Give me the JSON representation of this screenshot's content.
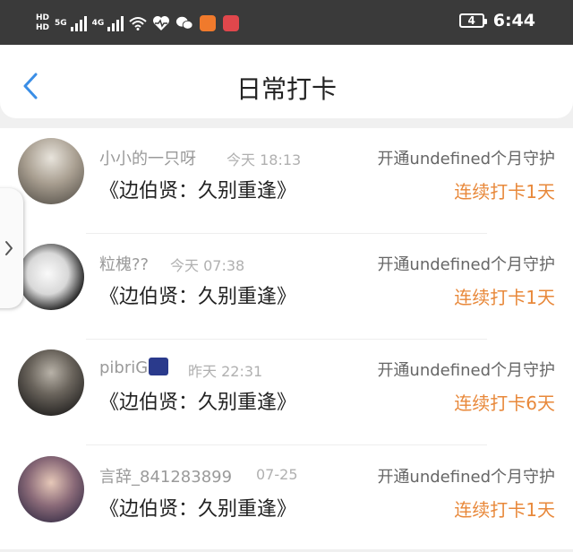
{
  "status_bar": {
    "hd1": "HD",
    "hd2": "HD",
    "net1": "5G",
    "net2": "4G",
    "battery": "4",
    "time": "6:44",
    "icons": [
      "signal-icon",
      "signal-icon",
      "wifi-icon",
      "heart-rate-icon",
      "wechat-icon",
      "video-app-icon",
      "reader-app-icon",
      "battery-icon"
    ]
  },
  "header": {
    "title": "日常打卡",
    "back_icon": "chevron-left-icon"
  },
  "colors": {
    "accent": "#3a8ee6",
    "streak": "#e8883a",
    "status_bar_bg": "#3a3a3a"
  },
  "checkins": [
    {
      "name": "小小的一只呀",
      "time": "今天 18:13",
      "guard": "开通undefined个月守护",
      "book": "《边伯贤：久别重逢》",
      "streak": "连续打卡1天"
    },
    {
      "name": "粒槐??",
      "time": "今天 07:38",
      "guard": "开通undefined个月守护",
      "book": "《边伯贤：久别重逢》",
      "streak": "连续打卡1天"
    },
    {
      "name": "pibriG",
      "time": "昨天 22:31",
      "guard": "开通undefined个月守护",
      "book": "《边伯贤：久别重逢》",
      "streak": "连续打卡6天"
    },
    {
      "name": "言辞_841283899",
      "time": "07-25",
      "guard": "开通undefined个月守护",
      "book": "《边伯贤：久别重逢》",
      "streak": "连续打卡1天"
    }
  ]
}
